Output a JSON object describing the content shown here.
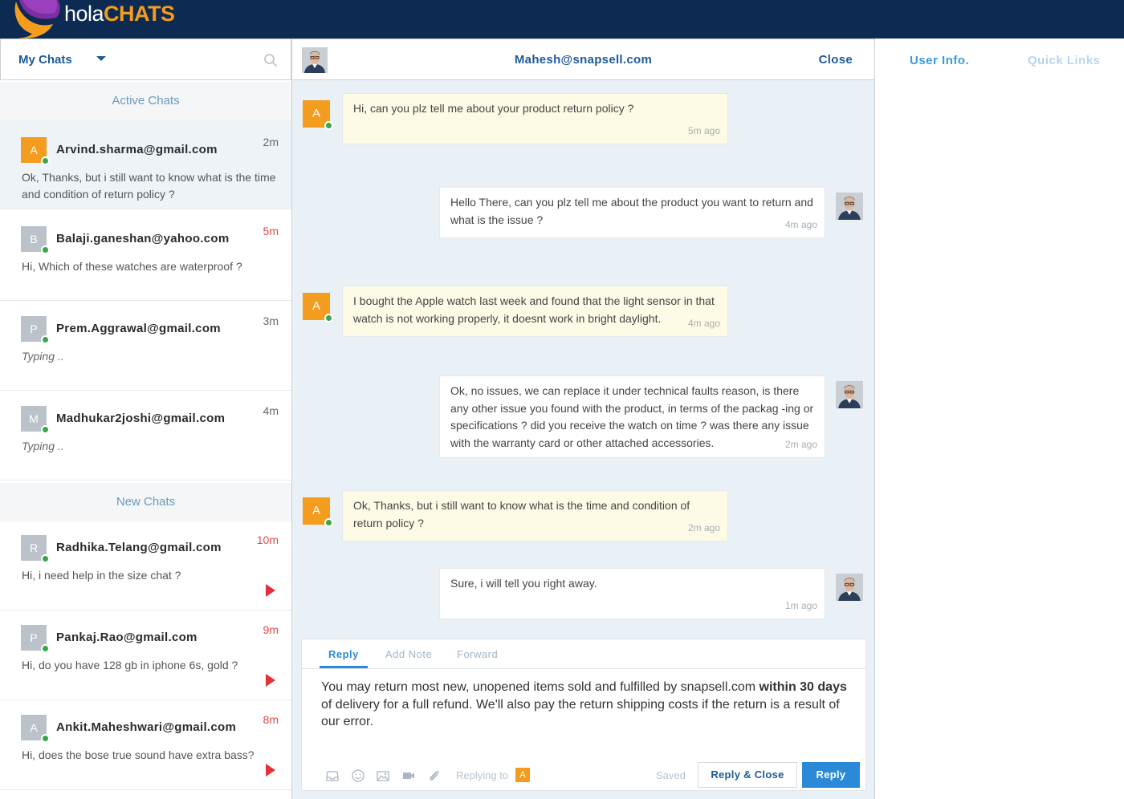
{
  "brand": {
    "part1": "hola",
    "part2": "CHATS"
  },
  "left": {
    "dropdown_label": "My Chats",
    "active_heading": "Active Chats",
    "new_heading": "New Chats",
    "active_chats": [
      {
        "initial": "A",
        "email": "Arvind.sharma@gmail.com",
        "time": "2m",
        "message": "Ok, Thanks, but i still want to know what is the time and condition of return policy ?"
      },
      {
        "initial": "B",
        "email": "Balaji.ganeshan@yahoo.com",
        "time": "5m",
        "message": "Hi, Which of these watches are waterproof ?"
      },
      {
        "initial": "P",
        "email": "Prem.Aggrawal@gmail.com",
        "time": "3m",
        "message": "Typing .."
      },
      {
        "initial": "M",
        "email": "Madhukar2joshi@gmail.com",
        "time": "4m",
        "message": "Typing .."
      }
    ],
    "new_chats": [
      {
        "initial": "R",
        "email": "Radhika.Telang@gmail.com",
        "time": "10m",
        "message": "Hi, i need help in the size chat ?"
      },
      {
        "initial": "P",
        "email": "Pankaj.Rao@gmail.com",
        "time": "9m",
        "message": "Hi, do you have 128 gb in iphone 6s, gold ?"
      },
      {
        "initial": "A",
        "email": "Ankit.Maheshwari@gmail.com",
        "time": "8m",
        "message": "Hi, does the bose true sound have extra bass?"
      }
    ]
  },
  "conversation": {
    "email": "Mahesh@snapsell.com",
    "close_label": "Close",
    "customer_initial": "A",
    "messages": [
      {
        "from": "customer",
        "text": "Hi, can you plz tell me about your product return policy ?",
        "time": "5m ago"
      },
      {
        "from": "agent",
        "text": "Hello There, can you plz tell me about the product you want to return and what is the issue ?",
        "time": "4m ago"
      },
      {
        "from": "customer",
        "text": "I bought the Apple watch last week and found that the light sensor in that watch is not working properly, it doesnt work in bright daylight.",
        "time": "4m ago"
      },
      {
        "from": "agent",
        "text": "Ok, no issues, we can replace it under technical faults reason, is there any other issue you found with the product, in terms of the packag -ing or specifications ? did you receive the watch on time ? was there any issue with the warranty card or other attached accessories.",
        "time": "2m ago"
      },
      {
        "from": "customer",
        "text": "Ok, Thanks, but i still want to know what is the time and condition of return policy ?",
        "time": "2m ago"
      },
      {
        "from": "agent",
        "text": "Sure, i will tell you right away.",
        "time": "1m ago"
      }
    ]
  },
  "composer": {
    "tabs": [
      "Reply",
      "Add Note",
      "Forward"
    ],
    "text_before": "You may return most new, unopened items sold and fulfilled by snapsell.com ",
    "text_bold": "within 30 days",
    "text_after": " of delivery for a full refund. We'll also pay the return shipping costs if the return is a result of our error.",
    "replying_to": "Replying to",
    "replying_initial": "A",
    "saved": "Saved",
    "reply_close": "Reply & Close",
    "reply": "Reply"
  },
  "right": {
    "tabs": [
      "User Info.",
      "Quick Links"
    ]
  },
  "colors": {
    "navy": "#0c2a52",
    "orange": "#f39c1d",
    "blue": "#2a8ad8",
    "online": "#3aa54a",
    "alert": "#e2313c"
  }
}
